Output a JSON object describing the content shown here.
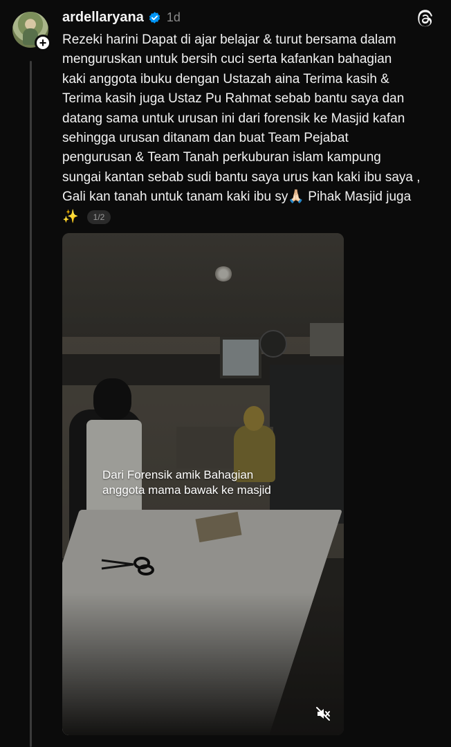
{
  "post": {
    "username": "ardellaryana",
    "time": "1d",
    "text": "Rezeki harini Dapat di ajar belajar & turut bersama dalam\nmenguruskan untuk bersih cuci serta kafankan bahagian\nkaki anggota ibuku dengan Ustazah aina Terima kasih &\nTerima kasih juga  Ustaz Pu Rahmat sebab bantu saya dan\ndatang sama untuk urusan ini dari forensik ke Masjid  kafan\nsehingga urusan ditanam dan buat Team Pejabat\npengurusan & Team Tanah perkuburan islam kampung\nsungai kantan sebab sudi bantu saya urus kan kaki ibu saya ,\nGali kan tanah untuk tanam kaki ibu sy🙏🏻 Pihak Masjid juga\n✨",
    "page_indicator": "1/2"
  },
  "media": {
    "caption": "Dari Forensik amik Bahagian\nanggota mama bawak ke masjid"
  },
  "icons": {
    "follow": "plus-icon",
    "verified": "verified-icon",
    "app": "threads-logo-icon",
    "mute": "mute-icon"
  },
  "colors": {
    "background": "#0b0b0b",
    "verified": "#0095f6",
    "muted_text": "#8a8a8a"
  }
}
